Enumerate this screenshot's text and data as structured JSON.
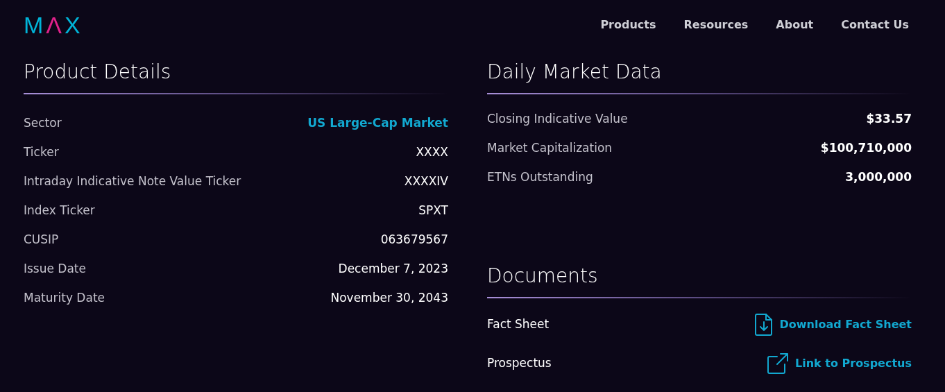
{
  "logo": [
    {
      "letter": "M",
      "color": "#00b4d8"
    },
    {
      "letter": "Λ",
      "color": "#e0218a"
    },
    {
      "letter": "X",
      "color": "#00b4d8"
    }
  ],
  "nav": [
    "Products",
    "Resources",
    "About",
    "Contact Us"
  ],
  "product_details": {
    "title": "Product Details",
    "rows": [
      {
        "label": "Sector",
        "value": "US Large-Cap Market",
        "kind": "link"
      },
      {
        "label": "Ticker",
        "value": "XXXX",
        "kind": "text"
      },
      {
        "label": "Intraday Indicative Note Value Ticker",
        "value": "XXXXIV",
        "kind": "text"
      },
      {
        "label": "Index Ticker",
        "value": "SPXT",
        "kind": "text"
      },
      {
        "label": "CUSIP",
        "value": "063679567",
        "kind": "text"
      },
      {
        "label": "Issue Date",
        "value": "December 7, 2023",
        "kind": "text"
      },
      {
        "label": "Maturity Date",
        "value": "November 30, 2043",
        "kind": "text"
      }
    ]
  },
  "daily_market_data": {
    "title": "Daily Market Data",
    "rows": [
      {
        "label": "Closing Indicative Value",
        "value": "$33.57"
      },
      {
        "label": "Market Capitalization",
        "value": "$100,710,000"
      },
      {
        "label": "ETNs Outstanding",
        "value": "3,000,000"
      }
    ]
  },
  "documents": {
    "title": "Documents",
    "rows": [
      {
        "label": "Fact Sheet",
        "link": "Download Fact Sheet",
        "kind": "download"
      },
      {
        "label": "Prospectus",
        "link": "Link to Prospectus",
        "kind": "external"
      }
    ]
  }
}
